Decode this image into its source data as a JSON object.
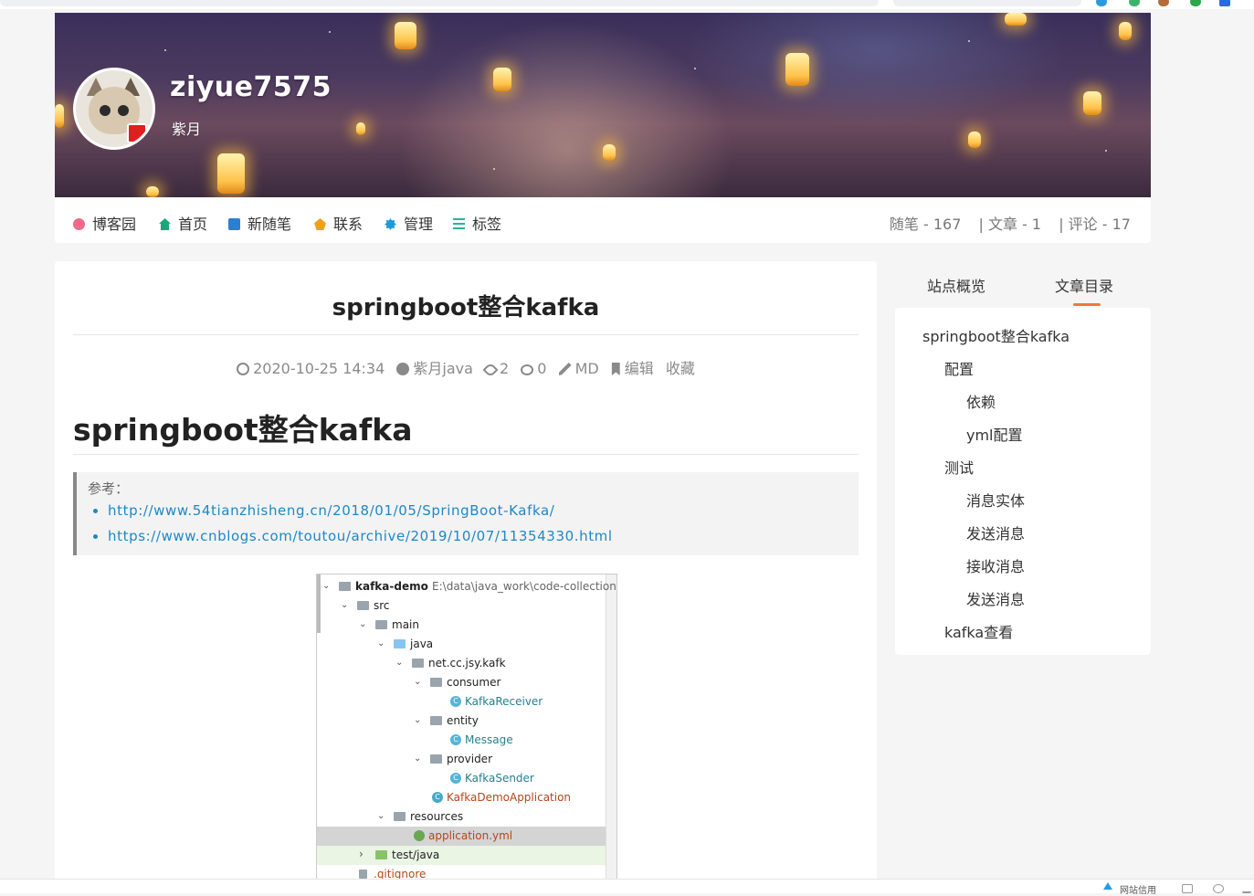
{
  "blog": {
    "title": "ziyue7575",
    "subtitle": "紫月"
  },
  "nav": {
    "items": [
      {
        "label": "博客园",
        "icon": "flower-icon",
        "color": "#f06a8a"
      },
      {
        "label": "首页",
        "icon": "home-icon",
        "color": "#1aa87a"
      },
      {
        "label": "新随笔",
        "icon": "new-post-icon",
        "color": "#2a7fd4"
      },
      {
        "label": "联系",
        "icon": "contact-icon",
        "color": "#f0a020"
      },
      {
        "label": "管理",
        "icon": "gear-icon",
        "color": "#1e9ad6"
      },
      {
        "label": "标签",
        "icon": "sliders-icon",
        "color": "#2ab0a0"
      }
    ],
    "stats": {
      "posts": "随笔 - 167",
      "articles": "| 文章 - 1",
      "comments": "| 评论 - 17"
    }
  },
  "post": {
    "title": "springboot整合kafka",
    "meta": {
      "date": "2020-10-25 14:34",
      "author": "紫月java",
      "views": "2",
      "comments": "0",
      "format": "MD",
      "edit": "编辑",
      "favorite": "收藏"
    },
    "heading": "springboot整合kafka",
    "quote": {
      "label": "参考：",
      "links": [
        "http://www.54tianzhisheng.cn/2018/01/05/SpringBoot-Kafka/",
        "https://www.cnblogs.com/toutou/archive/2019/10/07/11354330.html"
      ]
    },
    "tree": {
      "project": "kafka-demo",
      "project_path": "E:\\data\\java_work\\code-collection",
      "nodes": [
        "src",
        "main",
        "java",
        "net.cc.jsy.kafk",
        "consumer",
        "KafkaReceiver",
        "entity",
        "Message",
        "provider",
        "KafkaSender",
        "KafkaDemoApplication",
        "resources",
        "application.yml",
        "test/java",
        ".gitignore"
      ]
    }
  },
  "sidebar": {
    "tabs": [
      "站点概览",
      "文章目录"
    ],
    "active_tab": "文章目录",
    "toc": [
      "springboot整合kafka",
      "配置",
      "依赖",
      "yml配置",
      "测试",
      "消息实体",
      "发送消息",
      "接收消息",
      "发送消息",
      "kafka查看"
    ]
  },
  "statusbar": {
    "text": "网站信用"
  }
}
